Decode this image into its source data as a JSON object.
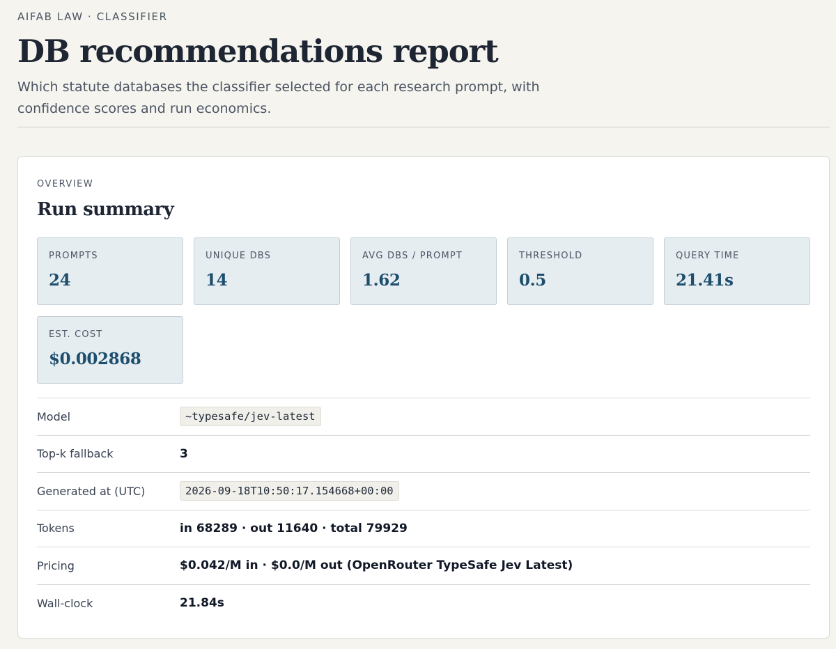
{
  "header": {
    "eyebrow": "AIFAB LAW · CLASSIFIER",
    "title": "DB recommendations report",
    "subtitle": "Which statute databases the classifier selected for each research prompt, with confidence scores and run economics."
  },
  "overview": {
    "eyebrow": "OVERVIEW",
    "title": "Run summary",
    "stats": [
      {
        "label": "PROMPTS",
        "value": "24"
      },
      {
        "label": "UNIQUE DBS",
        "value": "14"
      },
      {
        "label": "AVG DBS / PROMPT",
        "value": "1.62"
      },
      {
        "label": "THRESHOLD",
        "value": "0.5"
      },
      {
        "label": "QUERY TIME",
        "value": "21.41s"
      },
      {
        "label": "EST. COST",
        "value": "$0.002868"
      }
    ],
    "details": [
      {
        "label": "Model",
        "value": "~typesafe/jev-latest",
        "code": true
      },
      {
        "label": "Top-k fallback",
        "value": "3",
        "code": false
      },
      {
        "label": "Generated at (UTC)",
        "value": "2026-09-18T10:50:17.154668+00:00",
        "code": true
      },
      {
        "label": "Tokens",
        "value": "in 68289 · out 11640 · total 79929",
        "code": false
      },
      {
        "label": "Pricing",
        "value": "$0.042/M in · $0.0/M out (OpenRouter TypeSafe Jev Latest)",
        "code": false
      },
      {
        "label": "Wall-clock",
        "value": "21.84s",
        "code": false
      }
    ]
  }
}
